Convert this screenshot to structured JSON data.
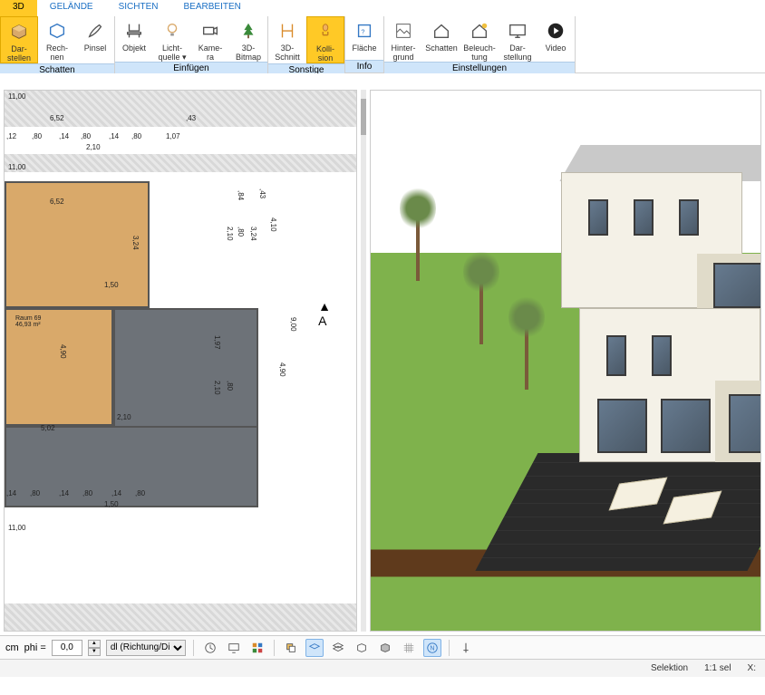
{
  "tabs": {
    "t0": "3D",
    "t1": "GELÄNDE",
    "t2": "SICHTEN",
    "t3": "BEARBEITEN"
  },
  "ribbon": {
    "groups": {
      "schatten": {
        "label": "Schatten"
      },
      "einfuegen": {
        "label": "Einfügen"
      },
      "sonstige": {
        "label": "Sonstige"
      },
      "info": {
        "label": "Info"
      },
      "einstellungen": {
        "label": "Einstellungen"
      }
    },
    "btn": {
      "darstellen": "Dar-\nstellen",
      "rechnen": "Rech-\nnen",
      "pinsel": "Pinsel",
      "objekt": "Objekt",
      "lichtquelle": "Licht-\nquelle ▾",
      "kamera": "Kame-\nra",
      "bitmap3d": "3D-\nBitmap",
      "schnitt3d": "3D-\nSchnitt",
      "kollision": "Kolli-\nsion",
      "flaeche": "Fläche",
      "hintergrund": "Hinter-\ngrund",
      "schatten": "Schatten",
      "beleuchtung": "Beleuch-\ntung",
      "darstellung": "Dar-\nstellung",
      "video": "Video"
    }
  },
  "plan": {
    "room_label": "Raum 69\n46,93 m²",
    "dims": {
      "d_1100a": "11,00",
      "d_652": "6,52",
      "d_43": ",43",
      "d_12": ",12",
      "d_80a": ",80",
      "d_14": ",14",
      "d_80b": ",80",
      "d_14b": ",14",
      "d_80c": ",80",
      "d_107": "1,07",
      "d_210a": "2,10",
      "d_1100b": "11,00",
      "d_84": ",84",
      "d_80d": ",80",
      "d_210b": "2,10",
      "d_324": "3,24",
      "d_410": "4,10",
      "d_150a": "1,50",
      "d_900": "9,00",
      "d_197": "1,97",
      "d_490a": "4,90",
      "d_490b": "4,90",
      "d_502": "5,02",
      "d_210c": "2,10",
      "d_80e": ",80",
      "d_150b": "1,50",
      "d_1100c": "11,00",
      "d_80f": ",80",
      "d_80g": ",80",
      "d_80h": ",80"
    },
    "north": "A"
  },
  "bottombar": {
    "unit": "cm",
    "phi_label": "phi =",
    "phi_value": "0,0",
    "dl_select": "dl (Richtung/Di"
  },
  "status": {
    "selektion": "Selektion",
    "scale": "1:1 sel",
    "x": "X:"
  }
}
